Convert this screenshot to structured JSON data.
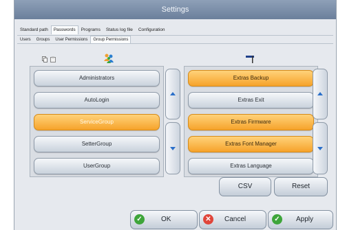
{
  "window": {
    "title": "Settings"
  },
  "tabs_primary": [
    {
      "label": "Standard path",
      "active": false
    },
    {
      "label": "Passwords",
      "active": true
    },
    {
      "label": "Programs",
      "active": false
    },
    {
      "label": "Status log file",
      "active": false
    },
    {
      "label": "Configuration",
      "active": false
    }
  ],
  "tabs_secondary": [
    {
      "label": "Users",
      "active": false
    },
    {
      "label": "Groups",
      "active": false
    },
    {
      "label": "User Permissions",
      "active": false
    },
    {
      "label": "Group Permissions",
      "active": true
    }
  ],
  "groups": {
    "header_icons": [
      "copy-icon",
      "paste-icon",
      "group-people-icon"
    ],
    "items": [
      {
        "label": "Administrators",
        "selected": false
      },
      {
        "label": "AutoLogin",
        "selected": false
      },
      {
        "label": "ServiceGroup",
        "selected": true
      },
      {
        "label": "SetterGroup",
        "selected": false
      },
      {
        "label": "UserGroup",
        "selected": false
      }
    ]
  },
  "permissions": {
    "header_icon": "permission-flag-icon",
    "items": [
      {
        "label": "Extras Backup",
        "granted": true
      },
      {
        "label": "Extras Exit",
        "granted": false
      },
      {
        "label": "Extras Firmware",
        "granted": true
      },
      {
        "label": "Extras Font Manager",
        "granted": true
      },
      {
        "label": "Extras Language",
        "granted": false
      }
    ]
  },
  "actions": {
    "csv_label": "CSV",
    "reset_label": "Reset"
  },
  "footer": {
    "ok_label": "OK",
    "cancel_label": "Cancel",
    "apply_label": "Apply"
  },
  "colors": {
    "selected_orange": "#f6a32b",
    "ok_green": "#3ea53a",
    "cancel_red": "#e0453a",
    "scroll_arrow_blue": "#2a6fc9"
  }
}
